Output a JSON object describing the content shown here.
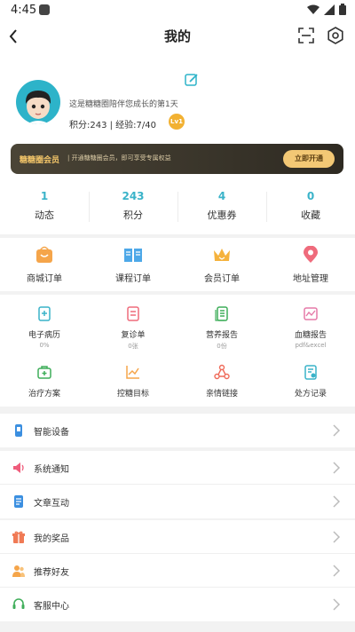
{
  "status_bar": {
    "time": "4:45"
  },
  "header": {
    "title": "我的"
  },
  "profile": {
    "tagline": "这是糖糖圈陪伴您成长的第1天",
    "score_text": "积分:243 | 经验:7/40",
    "level": "Lv1"
  },
  "vip": {
    "title": "糖糖圈会员",
    "desc": "| 开通糖糖圈会员，即可享受专属权益",
    "button": "立即开通"
  },
  "stats": [
    {
      "value": "1",
      "label": "动态"
    },
    {
      "value": "243",
      "label": "积分"
    },
    {
      "value": "4",
      "label": "优惠券"
    },
    {
      "value": "0",
      "label": "收藏"
    }
  ],
  "orders": [
    {
      "label": "商城订单",
      "icon": "shop-bag-icon"
    },
    {
      "label": "课程订单",
      "icon": "book-icon"
    },
    {
      "label": "会员订单",
      "icon": "crown-icon"
    },
    {
      "label": "地址管理",
      "icon": "location-pin-icon"
    }
  ],
  "health_row1": [
    {
      "label": "电子病历",
      "sub": "0%",
      "icon": "medical-record-icon"
    },
    {
      "label": "复诊单",
      "sub": "0张",
      "icon": "revisit-form-icon"
    },
    {
      "label": "营养报告",
      "sub": "0份",
      "icon": "nutrition-report-icon"
    },
    {
      "label": "血糖报告",
      "sub": "pdf&excel",
      "icon": "glucose-report-icon"
    }
  ],
  "health_row2": [
    {
      "label": "治疗方案",
      "icon": "treatment-kit-icon"
    },
    {
      "label": "控糖目标",
      "icon": "trend-chart-icon"
    },
    {
      "label": "亲情链接",
      "icon": "family-link-icon"
    },
    {
      "label": "处方记录",
      "icon": "prescription-icon"
    }
  ],
  "list_group1": [
    {
      "label": "智能设备",
      "icon": "smart-device-icon"
    }
  ],
  "list_group2": [
    {
      "label": "系统通知",
      "icon": "speaker-icon"
    },
    {
      "label": "文章互动",
      "icon": "article-icon"
    }
  ],
  "list_group3": [
    {
      "label": "我的奖品",
      "icon": "gift-icon"
    },
    {
      "label": "推荐好友",
      "icon": "friends-icon"
    },
    {
      "label": "客服中心",
      "icon": "headset-icon"
    }
  ],
  "colors": {
    "accent": "#3ab3c9",
    "vip_gold": "#f2c569",
    "level_badge": "#f2b132"
  }
}
